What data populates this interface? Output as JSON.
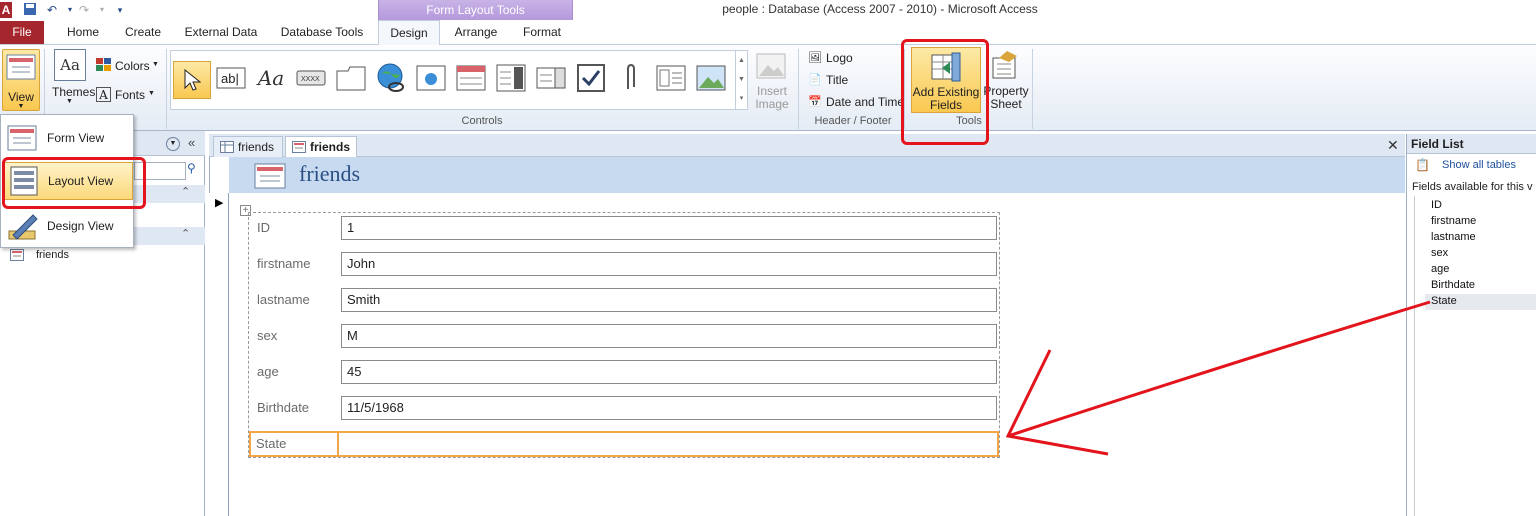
{
  "window": {
    "title": "people : Database (Access 2007 - 2010)  -  Microsoft Access",
    "context_tab_group": "Form Layout Tools"
  },
  "tabs": [
    "File",
    "Home",
    "Create",
    "External Data",
    "Database Tools",
    "Design",
    "Arrange",
    "Format"
  ],
  "ribbon": {
    "view_label": "View",
    "themes_label": "Themes",
    "colors_label": "Colors",
    "fonts_label": "Fonts",
    "controls_group": "Controls",
    "insert_image_label": "Insert Image",
    "logo_label": "Logo",
    "title_label": "Title",
    "date_time_label": "Date and Time",
    "header_footer_group": "Header / Footer",
    "add_existing_fields_label": "Add Existing Fields",
    "property_sheet_label": "Property Sheet",
    "tools_group": "Tools"
  },
  "view_menu": {
    "form_view": "Form View",
    "layout_view": "Layout View",
    "design_view": "Design View"
  },
  "nav": {
    "object_name": "friends"
  },
  "doc_tabs": [
    "friends",
    "friends"
  ],
  "form": {
    "title": "friends",
    "fields": [
      {
        "label": "ID",
        "value": "1"
      },
      {
        "label": "firstname",
        "value": "John"
      },
      {
        "label": "lastname",
        "value": "Smith"
      },
      {
        "label": "sex",
        "value": "M"
      },
      {
        "label": "age",
        "value": "45"
      },
      {
        "label": "Birthdate",
        "value": "11/5/1968"
      },
      {
        "label": "State",
        "value": ""
      }
    ]
  },
  "field_list": {
    "title": "Field List",
    "show_all": "Show all tables",
    "available": "Fields available for this v",
    "fields": [
      "ID",
      "firstname",
      "lastname",
      "sex",
      "age",
      "Birthdate",
      "State"
    ]
  },
  "colors": {
    "file_tab": "#a6262d",
    "annotation_red": "#e3141c",
    "selected_orange": "#f2a646",
    "header_blue": "#c7daf0"
  }
}
